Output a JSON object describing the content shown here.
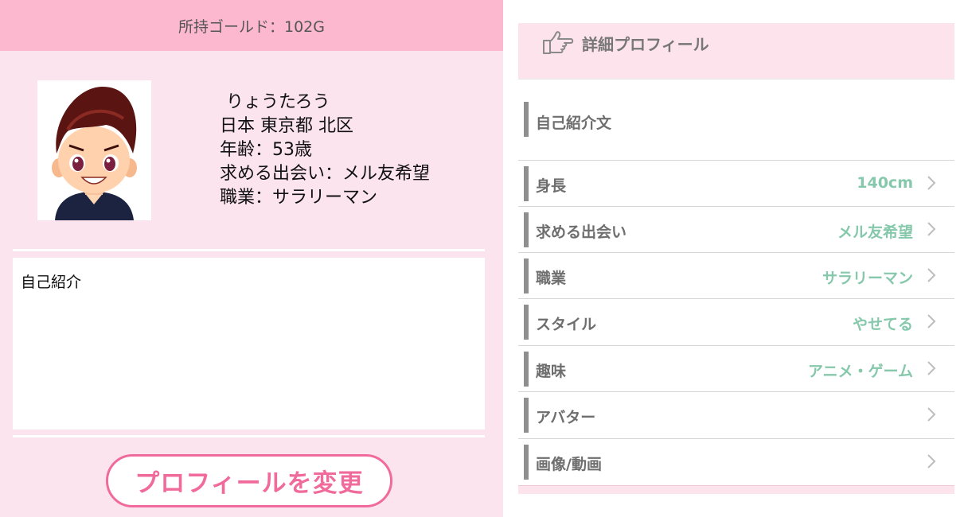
{
  "left": {
    "gold_text": "所持ゴールド：102G",
    "profile": {
      "name": "りょうたろう",
      "location": "日本 東京都 北区",
      "age": "年齢：53歳",
      "seeking": "求める出会い：メル友希望",
      "job": "職業：サラリーマン"
    },
    "intro_placeholder": "自己紹介",
    "change_button": "プロフィールを変更"
  },
  "right": {
    "header_title": "詳細プロフィール",
    "intro_label": "自己紹介文",
    "rows": [
      {
        "label": "身長",
        "value": "140cm"
      },
      {
        "label": "求める出会い",
        "value": "メル友希望"
      },
      {
        "label": "職業",
        "value": "サラリーマン"
      },
      {
        "label": "スタイル",
        "value": "やせてる"
      },
      {
        "label": "趣味",
        "value": "アニメ・ゲーム"
      },
      {
        "label": "アバター",
        "value": ""
      },
      {
        "label": "画像/動画",
        "value": ""
      }
    ]
  },
  "colors": {
    "pink_bg": "#fce4ee",
    "pink_bar": "#fcb8cf",
    "accent_pink": "#f06a9b",
    "value_green": "#86c8ab"
  },
  "icons": [
    "avatar-illustration",
    "pointing-hand-icon",
    "chevron-right-icon"
  ]
}
